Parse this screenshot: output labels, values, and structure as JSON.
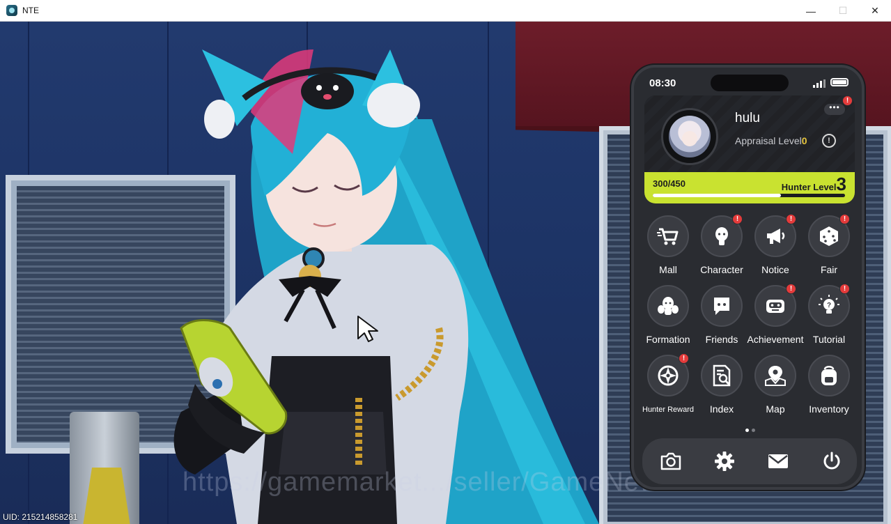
{
  "window": {
    "title": "NTE",
    "minimize": "—",
    "maximize": "☐",
    "close": "✕"
  },
  "hud": {
    "uid": "UID: 215214858281",
    "watermark": "https://gamemarket.../seller/GameNews"
  },
  "phone": {
    "time": "08:30",
    "profile": {
      "username": "hulu",
      "appraisal_label": "Appraisal Level",
      "appraisal_value": "0",
      "exp_text": "300/450",
      "exp_fraction": 0.667,
      "hunter_label": "Hunter Level",
      "hunter_value": "3",
      "more_badge": "!"
    },
    "apps": [
      {
        "label": "Mall",
        "icon": "cart-icon",
        "badge": ""
      },
      {
        "label": "Character",
        "icon": "character-icon",
        "badge": "!"
      },
      {
        "label": "Notice",
        "icon": "megaphone-icon",
        "badge": "!"
      },
      {
        "label": "Fair",
        "icon": "dice-icon",
        "badge": "!"
      },
      {
        "label": "Formation",
        "icon": "formation-icon",
        "badge": ""
      },
      {
        "label": "Friends",
        "icon": "chat-icon",
        "badge": ""
      },
      {
        "label": "Achievement",
        "icon": "robot-icon",
        "badge": "!"
      },
      {
        "label": "Tutorial",
        "icon": "lightbulb-icon",
        "badge": "!"
      },
      {
        "label": "Hunter Reward",
        "icon": "compass-icon",
        "badge": "!"
      },
      {
        "label": "Index",
        "icon": "document-search-icon",
        "badge": ""
      },
      {
        "label": "Map",
        "icon": "map-pin-icon",
        "badge": ""
      },
      {
        "label": "Inventory",
        "icon": "backpack-icon",
        "badge": ""
      }
    ],
    "dock": [
      {
        "icon": "camera-icon"
      },
      {
        "icon": "gear-icon"
      },
      {
        "icon": "mail-icon"
      },
      {
        "icon": "power-icon"
      }
    ],
    "page_count": 2,
    "active_page": 1
  },
  "colors": {
    "accent": "#c9e230",
    "badge": "#e43b3b",
    "phone_bg": "#2a2c31"
  }
}
